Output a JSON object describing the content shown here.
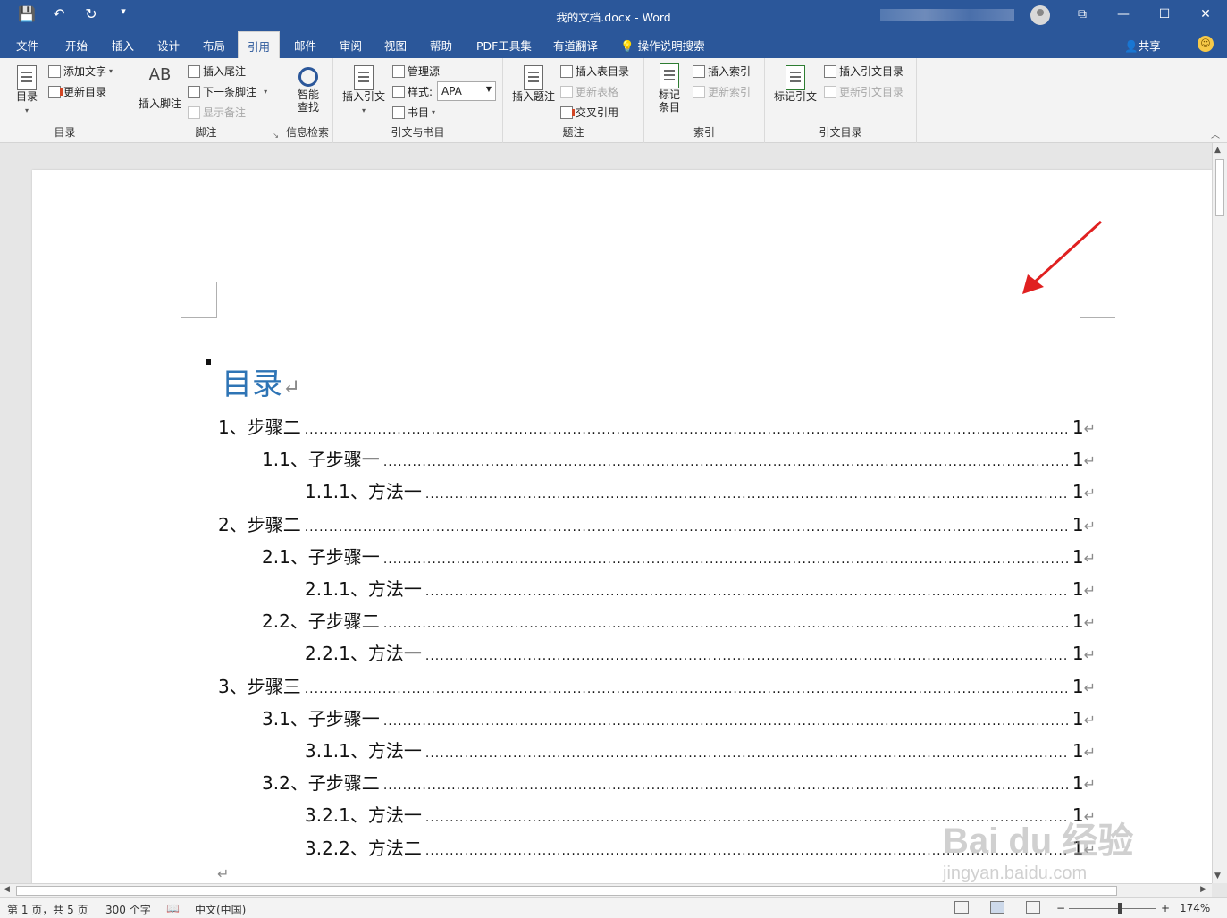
{
  "window": {
    "title": "我的文档.docx  -  Word",
    "minimize": "—",
    "restore": "☐",
    "close": "✕",
    "ribbon_display": "⧉"
  },
  "qat": {
    "save": "💾",
    "undo": "↶",
    "redo": "↻",
    "customize": "▾"
  },
  "tabs": [
    {
      "label": "文件"
    },
    {
      "label": "开始"
    },
    {
      "label": "插入"
    },
    {
      "label": "设计"
    },
    {
      "label": "布局"
    },
    {
      "label": "引用"
    },
    {
      "label": "邮件"
    },
    {
      "label": "审阅"
    },
    {
      "label": "视图"
    },
    {
      "label": "帮助"
    },
    {
      "label": "PDF工具集"
    },
    {
      "label": "有道翻译"
    }
  ],
  "tell_me": "操作说明搜索",
  "share": "共享",
  "ribbon": {
    "toc_group": {
      "label": "目录",
      "toc_button": "目录",
      "add_text": "添加文字",
      "update_toc": "更新目录"
    },
    "footnote_group": {
      "label": "脚注",
      "insert_footnote": "插入脚注",
      "insert_endnote": "插入尾注",
      "next_footnote": "下一条脚注",
      "show_notes": "显示备注",
      "ab_text": "AB"
    },
    "research_group": {
      "label": "信息检索",
      "smart_lookup": "智能查找"
    },
    "citation_group": {
      "label": "引文与书目",
      "insert_citation": "插入引文",
      "manage_sources": "管理源",
      "style_label": "样式:",
      "style_value": "APA",
      "bibliography": "书目"
    },
    "caption_group": {
      "label": "题注",
      "insert_caption": "插入题注",
      "insert_table_of_figures": "插入表目录",
      "update_table": "更新表格",
      "cross_reference": "交叉引用"
    },
    "index_group": {
      "label": "索引",
      "mark_entry": "标记条目",
      "insert_index": "插入索引",
      "update_index": "更新索引"
    },
    "authorities_group": {
      "label": "引文目录",
      "mark_citation": "标记引文",
      "insert_toa": "插入引文目录",
      "update_toa": "更新引文目录"
    }
  },
  "document": {
    "toc_title": "目录",
    "paragraph_mark": "↵",
    "entries": [
      {
        "label": "1、步骤二",
        "page": "1",
        "level": 1
      },
      {
        "label": "1.1、子步骤一",
        "page": "1",
        "level": 2
      },
      {
        "label": "1.1.1、方法一",
        "page": "1",
        "level": 3
      },
      {
        "label": "2、步骤二",
        "page": "1",
        "level": 1
      },
      {
        "label": "2.1、子步骤一",
        "page": "1",
        "level": 2
      },
      {
        "label": "2.1.1、方法一",
        "page": "1",
        "level": 3
      },
      {
        "label": "2.2、子步骤二",
        "page": "1",
        "level": 2
      },
      {
        "label": "2.2.1、方法一",
        "page": "1",
        "level": 3
      },
      {
        "label": "3、步骤三",
        "page": "1",
        "level": 1
      },
      {
        "label": "3.1、子步骤一",
        "page": "1",
        "level": 2
      },
      {
        "label": "3.1.1、方法一",
        "page": "1",
        "level": 3
      },
      {
        "label": "3.2、子步骤二",
        "page": "1",
        "level": 2
      },
      {
        "label": "3.2.1、方法一",
        "page": "1",
        "level": 3
      },
      {
        "label": "3.2.2、方法二",
        "page": "1",
        "level": 3
      }
    ]
  },
  "watermark": {
    "brand": "Bai du 经验",
    "url": "jingyan.baidu.com"
  },
  "status": {
    "page": "第 1 页，共 5 页",
    "words": "300 个字",
    "language": "中文(中国)",
    "zoom": "174%",
    "zoom_minus": "−",
    "zoom_plus": "+"
  },
  "colors": {
    "brand": "#2b579a",
    "heading": "#2e74b5",
    "annotation_arrow": "#e02020"
  }
}
